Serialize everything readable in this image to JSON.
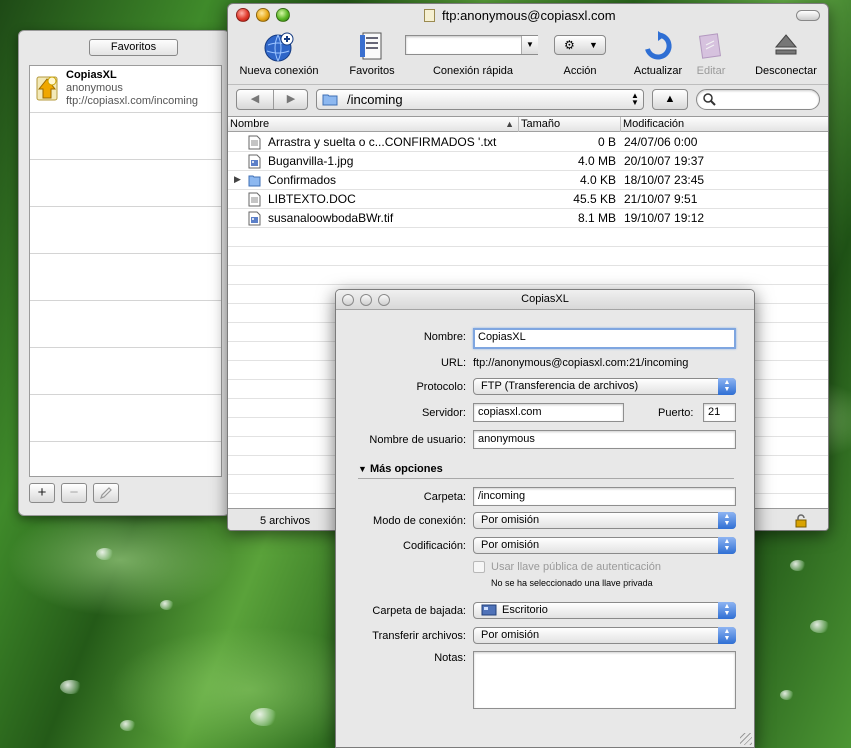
{
  "drawer": {
    "title": "Favoritos",
    "items": [
      {
        "name": "CopiasXL",
        "user": "anonymous",
        "url": "ftp://copiasxl.com/incoming"
      }
    ],
    "buttons": {
      "add": "+",
      "remove": "−"
    }
  },
  "window": {
    "title": "ftp:anonymous@copiasxl.com",
    "toolbar": {
      "new_connection": "Nueva conexión",
      "favorites": "Favoritos",
      "quick_connect": "Conexión rápida",
      "quick_connect_value": "",
      "action": "Acción",
      "refresh": "Actualizar",
      "edit": "Editar",
      "disconnect": "Desconectar"
    },
    "nav": {
      "back": "◀",
      "forward": "▶",
      "path": "/incoming",
      "up": "▲",
      "search_value": ""
    },
    "columns": {
      "name": "Nombre",
      "size": "Tamaño",
      "modified": "Modificación"
    },
    "files": [
      {
        "name": "Arrastra y suelta o c...CONFIRMADOS  '.txt",
        "size": "0 B",
        "modified": "24/07/06 0:00",
        "kind": "doc-icon"
      },
      {
        "name": "Buganvilla-1.jpg",
        "size": "4.0 MB",
        "modified": "20/10/07 19:37",
        "kind": "image-icon"
      },
      {
        "name": "Confirmados",
        "size": "4.0 KB",
        "modified": "18/10/07 23:45",
        "kind": "folder-icon"
      },
      {
        "name": "LIBTEXTO.DOC",
        "size": "45.5 KB",
        "modified": "21/10/07 9:51",
        "kind": "doc-icon"
      },
      {
        "name": "susanaloowbodaBWr.tif",
        "size": "8.1 MB",
        "modified": "19/10/07 19:12",
        "kind": "image-icon"
      }
    ],
    "status": "5 archivos"
  },
  "editor": {
    "title": "CopiasXL",
    "labels": {
      "nombre": "Nombre:",
      "url": "URL:",
      "protocolo": "Protocolo:",
      "servidor": "Servidor:",
      "puerto": "Puerto:",
      "usuario": "Nombre de usuario:",
      "mas_opciones": "Más opciones",
      "carpeta": "Carpeta:",
      "modo": "Modo de conexión:",
      "codificacion": "Codificación:",
      "usar_llave": "Usar llave pública de autenticación",
      "no_llave": "No se ha seleccionado una llave privada",
      "carpeta_bajada": "Carpeta de bajada:",
      "transferir": "Transferir archivos:",
      "notas": "Notas:"
    },
    "values": {
      "nombre": "CopiasXL",
      "url": "ftp://anonymous@copiasxl.com:21/incoming",
      "protocolo": "FTP (Transferencia de archivos)",
      "servidor": "copiasxl.com",
      "puerto": "21",
      "usuario": "anonymous",
      "carpeta": "/incoming",
      "modo": "Por omisión",
      "codificacion": "Por omisión",
      "carpeta_bajada": "Escritorio",
      "transferir": "Por omisión",
      "notas": ""
    }
  }
}
